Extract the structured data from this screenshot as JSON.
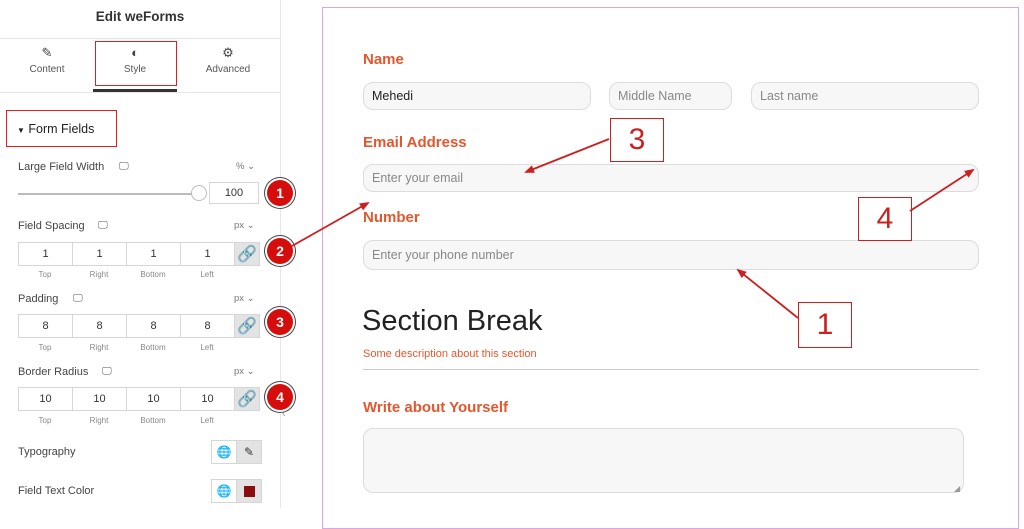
{
  "panel": {
    "title": "Edit weForms",
    "tabs": [
      {
        "label": "Content",
        "icon": "pencil-icon"
      },
      {
        "label": "Style",
        "icon": "contrast-icon"
      },
      {
        "label": "Advanced",
        "icon": "gear-icon"
      }
    ],
    "section": "Form Fields",
    "large_field_width": {
      "label": "Large Field Width",
      "unit": "%",
      "value": "100",
      "slider_level": 1.0,
      "badge": "1"
    },
    "field_spacing": {
      "label": "Field Spacing",
      "unit": "px",
      "values": [
        "1",
        "1",
        "1",
        "1"
      ],
      "badge": "2"
    },
    "padding": {
      "label": "Padding",
      "unit": "px",
      "values": [
        "8",
        "8",
        "8",
        "8"
      ],
      "badge": "3"
    },
    "border_radius": {
      "label": "Border Radius",
      "unit": "px",
      "values": [
        "10",
        "10",
        "10",
        "10"
      ],
      "badge": "4"
    },
    "sides": [
      "Top",
      "Right",
      "Bottom",
      "Left"
    ],
    "typography": "Typography",
    "field_text_color": {
      "label": "Field Text Color",
      "swatch": "#8b0d0d"
    }
  },
  "form": {
    "name_label": "Name",
    "first_name": "Mehedi",
    "middle_placeholder": "Middle Name",
    "last_placeholder": "Last name",
    "email_label": "Email Address",
    "email_placeholder": "Enter your email",
    "number_label": "Number",
    "number_placeholder": "Enter your phone number",
    "section_title": "Section Break",
    "section_desc": "Some description about this section",
    "about_label": "Write about Yourself"
  },
  "callouts": {
    "c1": "1",
    "c3": "3",
    "c4": "4"
  },
  "colors": {
    "accent": "#e4572e",
    "annotation": "#cc1f1f",
    "badge": "#d40d0d"
  }
}
